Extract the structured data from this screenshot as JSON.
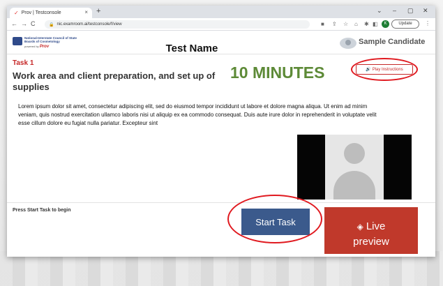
{
  "browser": {
    "tab_title": "Prov | Testconsole",
    "url": "nic.examroom.ai/testconsole/f/view",
    "update_label": "Update",
    "profile_initial": "K"
  },
  "header": {
    "logo_line1": "National-Interstate Council of State Boards of Cosmetology",
    "logo_powered": "powered by",
    "logo_brand": "Prov",
    "test_name": "Test Name",
    "candidate_name": "Sample Candidate"
  },
  "task": {
    "label": "Task 1",
    "title": "Work area and client preparation, and set up of supplies",
    "timer": "10 MINUTES",
    "play_instructions": "Play Instructions",
    "description": "Lorem ipsum dolor sit amet, consectetur adipiscing elit, sed do eiusmod tempor incididunt ut labore et dolore magna aliqua. Ut enim ad minim veniam, quis nostrud exercitation ullamco laboris nisi ut aliquip ex ea commodo consequat. Duis aute irure dolor in reprehenderit in voluptate velit esse cillum dolore eu fugiat nulla pariatur. Excepteur sint"
  },
  "footer": {
    "press_text": "Press Start Task to begin",
    "start_label": "Start Task",
    "live_label_1": "Live",
    "live_label_2": "preview"
  },
  "colors": {
    "accent_red": "#c62828",
    "timer_green": "#5d8a37",
    "start_blue": "#3b5a8c",
    "live_red": "#c0392b"
  }
}
